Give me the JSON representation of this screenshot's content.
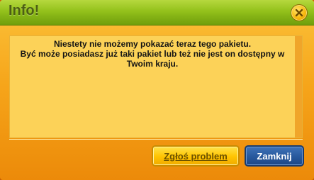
{
  "dialog": {
    "title": "Info!",
    "close_icon": "close-x-icon",
    "message_line1": "Niestety nie możemy pokazać teraz tego pakietu.",
    "message_line2": "Być może posiadasz już taki pakiet lub też nie jest on dostępny w",
    "message_line3": "Twoim kraju.",
    "buttons": {
      "report_label": "Zgłoś problem",
      "close_label": "Zamknij"
    }
  },
  "colors": {
    "titlebar": "#93c11b",
    "panel": "#fcd258",
    "report_button": "#ffc300",
    "close_button": "#27589d"
  }
}
